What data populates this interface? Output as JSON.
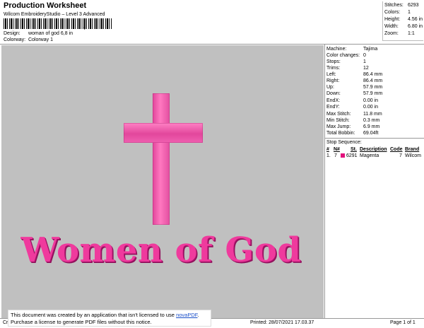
{
  "header": {
    "title": "Production Worksheet",
    "subtitle": "Wilcom EmbroideryStudio – Level 3 Advanced",
    "barcode_mark": ",",
    "design_label": "Design:",
    "design_value": "woman of god 6,8 in",
    "colorway_label": "Colorway:",
    "colorway_value": "Colorway 1"
  },
  "summary": [
    {
      "k": "Stitches:",
      "v": "6293"
    },
    {
      "k": "Colors:",
      "v": "1"
    },
    {
      "k": "Height:",
      "v": "4.56 in"
    },
    {
      "k": "Width:",
      "v": "6.80 in"
    },
    {
      "k": "Zoom:",
      "v": "1:1"
    }
  ],
  "design": {
    "text": "Women of God",
    "thread_color": "#e2127c",
    "background": "#c0c0c0"
  },
  "machine_info": [
    {
      "k": "Machine:",
      "v": "Tajima"
    },
    {
      "k": "Color changes:",
      "v": "0"
    },
    {
      "k": "Stops:",
      "v": "1"
    },
    {
      "k": "Trims:",
      "v": "12"
    },
    {
      "k": "Left:",
      "v": "86.4 mm"
    },
    {
      "k": "Right:",
      "v": "86.4 mm"
    },
    {
      "k": "Up:",
      "v": "57.9 mm"
    },
    {
      "k": "Down:",
      "v": "57.9 mm"
    },
    {
      "k": "EndX:",
      "v": "0.00 in"
    },
    {
      "k": "EndY:",
      "v": "0.00 in"
    },
    {
      "k": "Max Stitch:",
      "v": "11.8 mm"
    },
    {
      "k": "Min Stitch:",
      "v": "0.3 mm"
    },
    {
      "k": "Max Jump:",
      "v": "6.9 mm"
    },
    {
      "k": "Total Bobbin:",
      "v": "69.04ft"
    }
  ],
  "stop_sequence": {
    "title": "Stop Sequence:",
    "headers": {
      "num": "#",
      "n": "N#",
      "st": "St.",
      "desc": "Description",
      "code": "Code",
      "brand": "Brand"
    },
    "row": {
      "num": "1.",
      "n": "7",
      "st": "6291",
      "desc": "Magenta",
      "code": "7",
      "brand": "Wilcom"
    }
  },
  "footer": {
    "left": "Cr",
    "printed": "Printed: 28/07/2021 17.03.37",
    "page": "Page 1 of 1"
  },
  "notice": {
    "line1": "This document was created by an application that isn't licensed to use",
    "link": "novaPDF",
    "line1_end": ".",
    "line2": "Purchase a license to generate PDF files without this notice."
  }
}
